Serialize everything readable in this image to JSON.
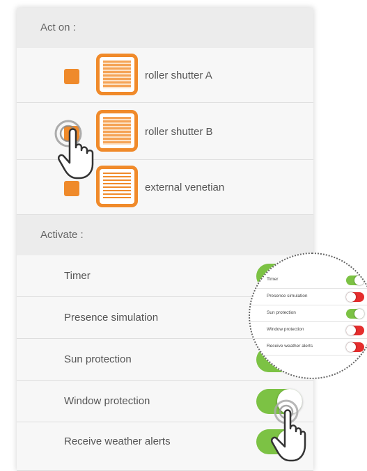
{
  "act_on": {
    "header": "Act on :",
    "devices": [
      {
        "label": "roller shutter A",
        "icon": "roller-shutter-icon",
        "selected": true
      },
      {
        "label": "roller shutter B",
        "icon": "roller-shutter-icon",
        "selected": true
      },
      {
        "label": "external venetian",
        "icon": "venetian-blind-icon",
        "selected": true
      }
    ]
  },
  "activate": {
    "header": "Activate :",
    "options": [
      {
        "label": "Timer",
        "enabled": true
      },
      {
        "label": "Presence simulation",
        "enabled": false
      },
      {
        "label": "Sun protection",
        "enabled": true
      },
      {
        "label": "Window protection",
        "enabled": true
      },
      {
        "label": "Receive weather alerts",
        "enabled": true
      }
    ]
  },
  "zoom": {
    "options": [
      {
        "label": "Timer",
        "state": "on"
      },
      {
        "label": "Presence simulation",
        "state": "off"
      },
      {
        "label": "Sun protection",
        "state": "on"
      },
      {
        "label": "Window protection",
        "state": "off"
      },
      {
        "label": "Receive weather alerts",
        "state": "off"
      }
    ]
  },
  "colors": {
    "accent": "#f08a2a",
    "toggle_on": "#7cc244",
    "toggle_off": "#e52d2d"
  }
}
